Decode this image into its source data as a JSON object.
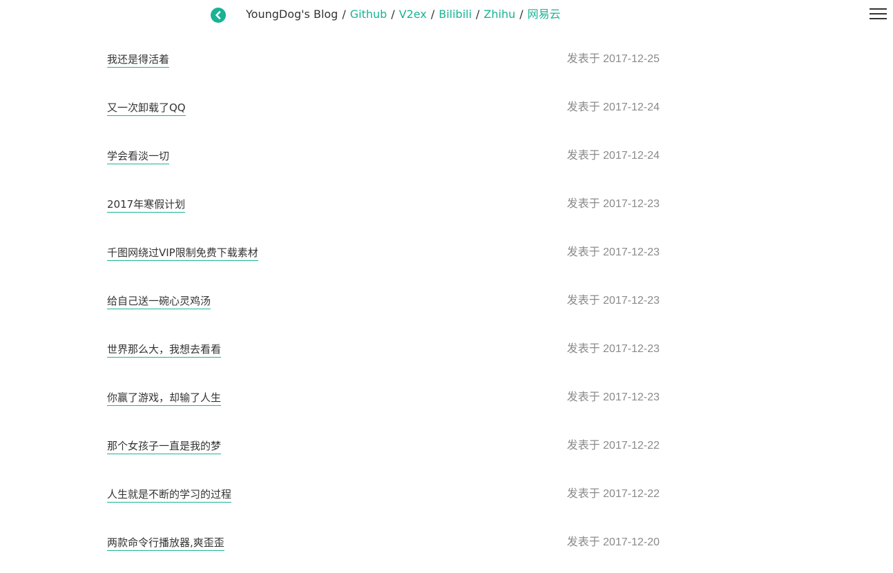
{
  "header": {
    "back_icon": "chevron-left-circle-icon",
    "site_title": "YoungDog's Blog",
    "separator": "/",
    "links": [
      {
        "label": "Github"
      },
      {
        "label": "V2ex"
      },
      {
        "label": "Bilibili"
      },
      {
        "label": "Zhihu"
      },
      {
        "label": "网易云"
      }
    ],
    "menu_icon": "hamburger-menu-icon"
  },
  "colors": {
    "accent": "#19b394",
    "text": "#333333",
    "date": "#8a8a8a"
  },
  "posts": [
    {
      "title": "我还是得活着",
      "date": "发表于 2017-12-25"
    },
    {
      "title": "又一次卸载了QQ",
      "date": "发表于 2017-12-24"
    },
    {
      "title": "学会看淡一切",
      "date": "发表于 2017-12-24"
    },
    {
      "title": "2017年寒假计划",
      "date": "发表于 2017-12-23"
    },
    {
      "title": "千图网绕过VIP限制免费下载素材",
      "date": "发表于 2017-12-23"
    },
    {
      "title": "给自己送一碗心灵鸡汤",
      "date": "发表于 2017-12-23"
    },
    {
      "title": "世界那么大，我想去看看",
      "date": "发表于 2017-12-23"
    },
    {
      "title": "你赢了游戏，却输了人生",
      "date": "发表于 2017-12-23"
    },
    {
      "title": "那个女孩子一直是我的梦",
      "date": "发表于 2017-12-22"
    },
    {
      "title": "人生就是不断的学习的过程",
      "date": "发表于 2017-12-22"
    },
    {
      "title": "两款命令行播放器,爽歪歪",
      "date": "发表于 2017-12-20"
    }
  ]
}
